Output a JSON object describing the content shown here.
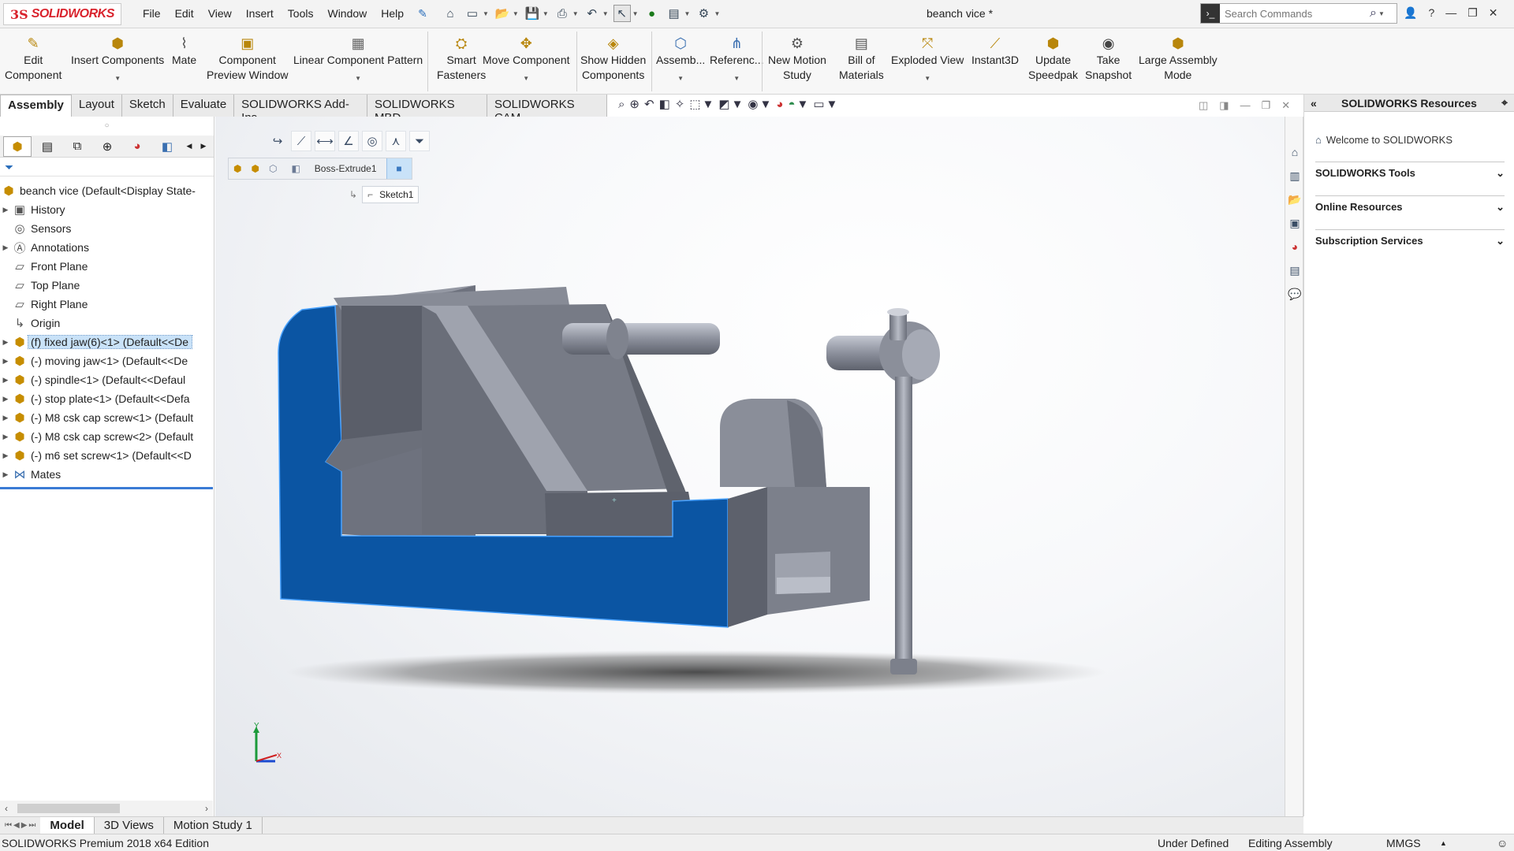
{
  "titlebar": {
    "app_brand_ds": "3S",
    "app_brand": "SOLIDWORKS",
    "menus": [
      "File",
      "Edit",
      "View",
      "Insert",
      "Tools",
      "Window",
      "Help"
    ],
    "document_title": "beanch vice *",
    "search_placeholder": "Search Commands"
  },
  "ribbon": {
    "buttons": [
      {
        "line1": "Edit",
        "line2": "Component"
      },
      {
        "line1": "Insert Components",
        "line2": ""
      },
      {
        "line1": "Mate",
        "line2": ""
      },
      {
        "line1": "Component",
        "line2": "Preview Window"
      },
      {
        "line1": "Linear Component Pattern",
        "line2": ""
      },
      {
        "line1": "Smart",
        "line2": "Fasteners"
      },
      {
        "line1": "Move Component",
        "line2": ""
      },
      {
        "line1": "Show Hidden",
        "line2": "Components"
      },
      {
        "line1": "Assemb...",
        "line2": ""
      },
      {
        "line1": "Referenc...",
        "line2": ""
      },
      {
        "line1": "New Motion",
        "line2": "Study"
      },
      {
        "line1": "Bill of",
        "line2": "Materials"
      },
      {
        "line1": "Exploded View",
        "line2": ""
      },
      {
        "line1": "Instant3D",
        "line2": ""
      },
      {
        "line1": "Update",
        "line2": "Speedpak"
      },
      {
        "line1": "Take",
        "line2": "Snapshot"
      },
      {
        "line1": "Large Assembly",
        "line2": "Mode"
      }
    ]
  },
  "tabs": [
    "Assembly",
    "Layout",
    "Sketch",
    "Evaluate",
    "SOLIDWORKS Add-Ins",
    "SOLIDWORKS MBD",
    "SOLIDWORKS CAM"
  ],
  "tree": {
    "root": "beanch vice  (Default<Display State-",
    "items": [
      "History",
      "Sensors",
      "Annotations",
      "Front Plane",
      "Top Plane",
      "Right Plane",
      "Origin",
      "(f) fixed jaw(6)<1> (Default<<De",
      "(-) moving jaw<1> (Default<<De",
      "(-) spindle<1> (Default<<Defaul",
      "(-) stop plate<1> (Default<<Defa",
      "(-) M8 csk cap screw<1> (Default",
      "(-) M8 csk cap screw<2> (Default",
      "(-) m6 set screw<1> (Default<<D",
      "Mates"
    ]
  },
  "viewport": {
    "breadcrumb_feature": "Boss-Extrude1",
    "breadcrumb_sketch": "Sketch1",
    "axis_y": "Y",
    "axis_x": "X"
  },
  "taskpane": {
    "title": "SOLIDWORKS Resources",
    "welcome": "Welcome to SOLIDWORKS",
    "sections": [
      "SOLIDWORKS Tools",
      "Online Resources",
      "Subscription Services"
    ]
  },
  "bottom_tabs": [
    "Model",
    "3D Views",
    "Motion Study 1"
  ],
  "status": {
    "edition": "SOLIDWORKS Premium 2018 x64 Edition",
    "definition": "Under Defined",
    "mode": "Editing Assembly",
    "units": "MMGS"
  },
  "colors": {
    "selected_face": "#0b55a3",
    "model_gray": "#7b7f8c",
    "brand_red": "#d9232d"
  }
}
